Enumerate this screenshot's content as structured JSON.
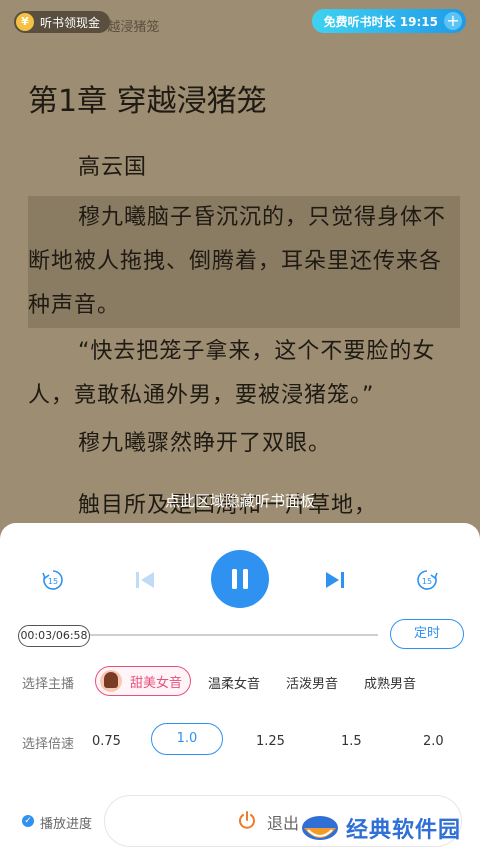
{
  "top_bar": {
    "cash_label": "听书领现金",
    "chapter_hint": "第1章 穿越浸猪笼",
    "free_listen_label": "免费听书时长 19:15",
    "plus_icon": "+"
  },
  "content": {
    "chapter_title": "第1章  穿越浸猪笼",
    "paragraphs": [
      "高云国",
      "穆九曦脑子昏沉沉的，只觉得身体不断地被人拖拽、倒腾着，耳朵里还传来各种声音。",
      "“快去把笼子拿来，这个不要脸的女人，竟敢私通外男，要被浸猪笼。”",
      "穆九曦骤然睁开了双眼。",
      "触目所及是四周和一片草地，"
    ],
    "hide_hint": "点此区域隐藏听书面板"
  },
  "player": {
    "rewind_label": "15",
    "forward_label": "15",
    "time_readout": "00:03/06:58",
    "timer_label": "定时",
    "voice_row_label": "选择主播",
    "voices": [
      "甜美女音",
      "温柔女音",
      "活泼男音",
      "成熟男音"
    ],
    "speed_row_label": "选择倍速",
    "speeds": [
      "0.75",
      "1.0",
      "1.25",
      "1.5",
      "2.0"
    ],
    "progress_check_label": "播放进度",
    "exit_label": "退出"
  },
  "watermark": {
    "text": "经典软件园"
  },
  "colors": {
    "accent": "#2f92f0",
    "voice_accent": "#e8507c",
    "reader_bg": "#9d8e73"
  }
}
